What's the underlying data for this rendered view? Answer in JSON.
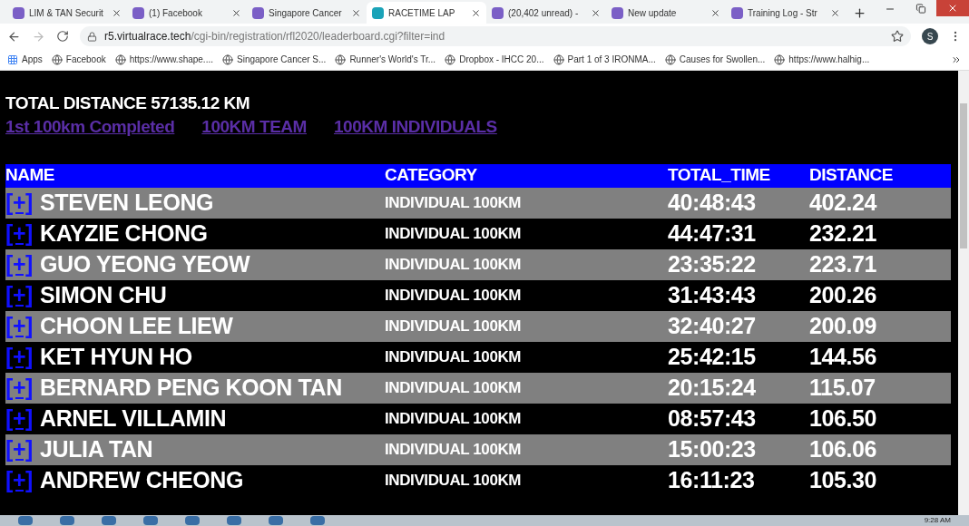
{
  "tabs": [
    {
      "title": "LIM & TAN Securit",
      "selected": false
    },
    {
      "title": "(1) Facebook",
      "selected": false
    },
    {
      "title": "Singapore Cancer",
      "selected": false
    },
    {
      "title": "RACETIME LAP",
      "selected": true
    },
    {
      "title": "(20,402 unread) -",
      "selected": false
    },
    {
      "title": "New update",
      "selected": false
    },
    {
      "title": "Training Log - Str",
      "selected": false
    }
  ],
  "address": {
    "host": "r5.virtualrace.tech",
    "path": "/cgi-bin/registration/rfl2020/leaderboard.cgi?filter=ind"
  },
  "profile": "S",
  "bookmarks": [
    "Apps",
    "Facebook",
    "https://www.shape....",
    "Singapore Cancer S...",
    "Runner's World's Tr...",
    "Dropbox - IHCC 20...",
    "Part 1 of 3 IRONMA...",
    "Causes for Swollen...",
    "https://www.halhig..."
  ],
  "total": "TOTAL DISTANCE 57135.12 KM",
  "links": [
    "1st 100km Completed",
    "100KM TEAM",
    "100KM INDIVIDUALS"
  ],
  "table": {
    "columns": [
      "NAME",
      "CATEGORY",
      "TOTAL_TIME",
      "DISTANCE"
    ],
    "rows": [
      {
        "toggle": "[+]",
        "name": "STEVEN LEONG",
        "category": "INDIVIDUAL 100KM",
        "time": "40:48:43",
        "distance": "402.24"
      },
      {
        "toggle": "[+]",
        "name": "KAYZIE CHONG",
        "category": "INDIVIDUAL 100KM",
        "time": "44:47:31",
        "distance": "232.21"
      },
      {
        "toggle": "[+]",
        "name": "GUO YEONG YEOW",
        "category": "INDIVIDUAL 100KM",
        "time": "23:35:22",
        "distance": "223.71"
      },
      {
        "toggle": "[+]",
        "name": "SIMON CHU",
        "category": "INDIVIDUAL 100KM",
        "time": "31:43:43",
        "distance": "200.26"
      },
      {
        "toggle": "[+]",
        "name": "CHOON LEE LIEW",
        "category": "INDIVIDUAL 100KM",
        "time": "32:40:27",
        "distance": "200.09"
      },
      {
        "toggle": "[+]",
        "name": "KET HYUN HO",
        "category": "INDIVIDUAL 100KM",
        "time": "25:42:15",
        "distance": "144.56"
      },
      {
        "toggle": "[+]",
        "name": "BERNARD PENG KOON TAN",
        "category": "INDIVIDUAL 100KM",
        "time": "20:15:24",
        "distance": "115.07"
      },
      {
        "toggle": "[+]",
        "name": "ARNEL VILLAMIN",
        "category": "INDIVIDUAL 100KM",
        "time": "08:57:43",
        "distance": "106.50"
      },
      {
        "toggle": "[+]",
        "name": "JULIA TAN",
        "category": "INDIVIDUAL 100KM",
        "time": "15:00:23",
        "distance": "106.06"
      },
      {
        "toggle": "[+]",
        "name": "ANDREW CHEONG",
        "category": "INDIVIDUAL 100KM",
        "time": "16:11:23",
        "distance": "105.30"
      }
    ]
  },
  "clock": "9:28 AM"
}
